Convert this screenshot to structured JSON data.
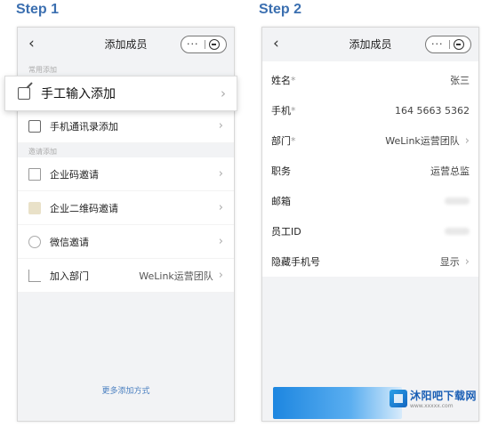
{
  "step1": {
    "label": "Step 1",
    "nav": {
      "back": "‹",
      "title": "添加成员",
      "menu_dots": "···"
    },
    "section1": "常用添加",
    "highlight_item": {
      "label": "手工输入添加",
      "icon": "edit-document-icon"
    },
    "items_group1": [
      {
        "label": "手机通讯录添加",
        "icon": "phone-contacts-icon"
      }
    ],
    "section2": "邀请添加",
    "items_group2": [
      {
        "label": "企业码邀请",
        "icon": "building-code-icon",
        "value": ""
      },
      {
        "label": "企业二维码邀请",
        "icon": "qr-code-icon",
        "value": ""
      },
      {
        "label": "微信邀请",
        "icon": "wechat-icon",
        "value": ""
      },
      {
        "label": "加入部门",
        "icon": "org-tree-icon",
        "value": "WeLink运营团队"
      }
    ],
    "more": "更多添加方式"
  },
  "step2": {
    "label": "Step 2",
    "nav": {
      "back": "‹",
      "title": "添加成员",
      "menu_dots": "···"
    },
    "fields": [
      {
        "label": "姓名",
        "required": "*",
        "value": "张三"
      },
      {
        "label": "手机",
        "required": "*",
        "value": "164 5663 5362"
      },
      {
        "label": "部门",
        "required": "*",
        "value": "WeLink运营团队"
      },
      {
        "label": "职务",
        "required": "",
        "value": "运营总监"
      },
      {
        "label": "邮箱",
        "required": "",
        "value": ""
      },
      {
        "label": "员工ID",
        "required": "",
        "value": ""
      },
      {
        "label": "隐藏手机号",
        "required": "",
        "value": "显示"
      }
    ]
  },
  "watermark": {
    "name": "沐阳吧下载网",
    "url": "www.xxxxx.com"
  },
  "colors": {
    "accent": "#1d86e0",
    "step_label": "#3b6fb0",
    "link": "#4a7fc0"
  }
}
